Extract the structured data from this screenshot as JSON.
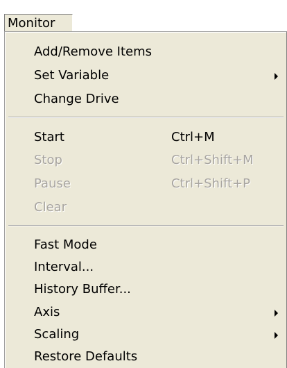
{
  "menubar": {
    "title": "Monitor"
  },
  "menu": {
    "items": [
      {
        "label": "Add/Remove Items"
      },
      {
        "label": "Set Variable",
        "submenu": true
      },
      {
        "label": "Change Drive"
      },
      {
        "label": "Start",
        "shortcut": "Ctrl+M"
      },
      {
        "label": "Stop",
        "shortcut": "Ctrl+Shift+M",
        "disabled": true
      },
      {
        "label": "Pause",
        "shortcut": "Ctrl+Shift+P",
        "disabled": true
      },
      {
        "label": "Clear",
        "disabled": true
      },
      {
        "label": "Fast Mode"
      },
      {
        "label": "Interval..."
      },
      {
        "label": "History Buffer..."
      },
      {
        "label": "Axis",
        "submenu": true
      },
      {
        "label": "Scaling",
        "submenu": true
      },
      {
        "label": "Restore Defaults"
      }
    ]
  },
  "colors": {
    "menu_background": "#ece9d8",
    "disabled_text": "#a8a5a0"
  },
  "icons": {
    "submenu": "submenu-arrow-icon"
  }
}
